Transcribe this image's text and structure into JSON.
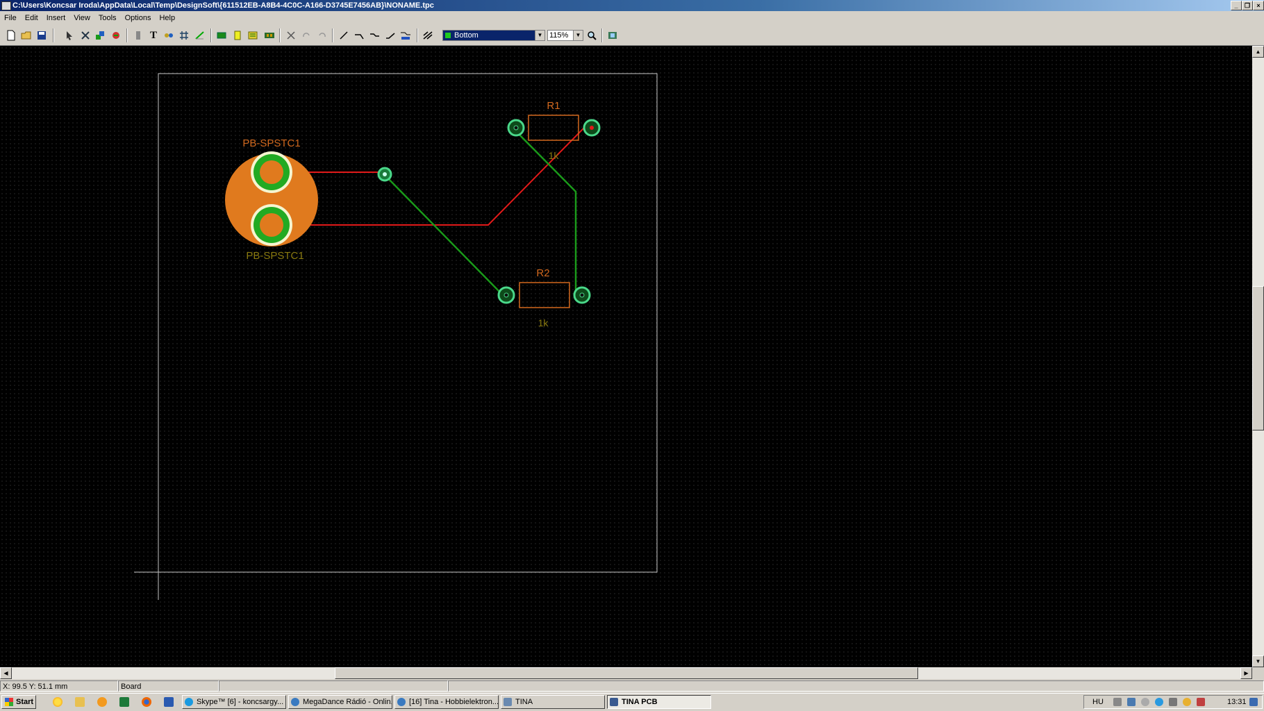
{
  "window": {
    "title": "C:\\Users\\Koncsar Iroda\\AppData\\Local\\Temp\\DesignSoft\\{611512EB-A8B4-4C0C-A166-D3745E7456AB}\\NONAME.tpc",
    "controls": [
      "minimize",
      "restore",
      "close"
    ]
  },
  "menu": {
    "items": [
      "File",
      "Edit",
      "Insert",
      "View",
      "Tools",
      "Options",
      "Help"
    ]
  },
  "toolbar": {
    "layer": "Bottom",
    "zoom": "115%"
  },
  "board": {
    "components": {
      "switch_ref": "PB-SPSTC1",
      "switch_value": "PB-SPSTC1",
      "r1_ref": "R1",
      "r1_value": "1k",
      "r2_ref": "R2",
      "r2_value": "1k"
    },
    "colors": {
      "background": "#000000",
      "board_outline": "#c8c8c8",
      "top_track": "#e21a1a",
      "bottom_track": "#1a9a1a",
      "pad_copper": "#e07a1e",
      "pad_ring": "#22aa22",
      "via": "#4ad88a",
      "silkscreen": "#d2691e",
      "value_text": "#8a7a10"
    }
  },
  "status": {
    "coords": "X: 99.5  Y: 51.1 mm",
    "layer": "Board"
  },
  "taskbar": {
    "start": "Start",
    "tasks": [
      {
        "label": "Skype™ [6] - koncsargy...",
        "active": false
      },
      {
        "label": "MegaDance Rádió - Onlin...",
        "active": false
      },
      {
        "label": "[16] Tina - Hobbielektron...",
        "active": false
      },
      {
        "label": "TINA",
        "active": false
      },
      {
        "label": "TINA PCB",
        "active": true
      }
    ],
    "language": "HU",
    "clock": "13:31"
  }
}
